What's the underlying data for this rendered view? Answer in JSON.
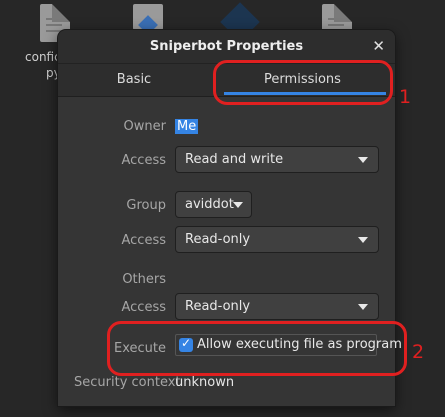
{
  "desktop": {
    "icons": [
      {
        "name": "document-icon",
        "label": "config"
      },
      {
        "name": "document-icon",
        "label": "py"
      },
      {
        "name": "app-icon",
        "label": ""
      },
      {
        "name": "app-icon",
        "label": ""
      },
      {
        "name": "document-icon",
        "label": ""
      }
    ],
    "partial_label_1": "confic",
    "partial_label_2": "py"
  },
  "dialog": {
    "title": "Sniperbot Properties",
    "close_icon": "close-icon",
    "tabs": [
      {
        "label": "Basic",
        "selected": false
      },
      {
        "label": "Permissions",
        "selected": true
      }
    ]
  },
  "permissions": {
    "owner_label": "Owner",
    "owner_value": "Me",
    "owner_access_label": "Access",
    "owner_access_value": "Read and write",
    "group_label": "Group",
    "group_value": "aviddot",
    "group_access_label": "Access",
    "group_access_value": "Read-only",
    "others_label": "Others",
    "others_access_label": "Access",
    "others_access_value": "Read-only",
    "execute_label": "Execute",
    "execute_checkbox_label": "Allow executing file as program",
    "execute_checked": true,
    "security_context_label": "Security context",
    "security_context_value": "unknown"
  },
  "annotations": {
    "marker_1": "1",
    "marker_2": "2",
    "color": "#e02020"
  },
  "colors": {
    "accent": "#3584e4",
    "dialog_bg": "#353535",
    "desktop_bg": "#272727"
  }
}
